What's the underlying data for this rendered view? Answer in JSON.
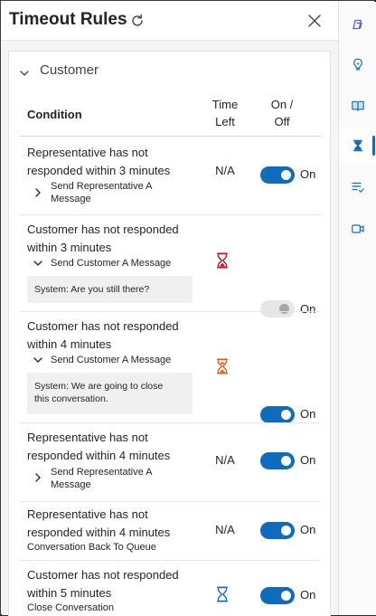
{
  "header": {
    "title": "Timeout Rules"
  },
  "section": {
    "title": "Customer"
  },
  "columns": {
    "condition": "Condition",
    "time_left_1": "Time",
    "time_left_2": "Left",
    "on_off_1": "On /",
    "on_off_2": "Off"
  },
  "rules": [
    {
      "condition_1": "Representative has not",
      "condition_2": "responded within 3 minutes",
      "action_1": "Send Representative A",
      "action_2": "Message",
      "time_left": "N/A",
      "toggle_state": "on",
      "toggle_label": "On"
    },
    {
      "condition_1": "Customer has not responded",
      "condition_2": "within 3 minutes",
      "action": "Send Customer A Message",
      "message": "System: Are you still there?",
      "time_icon": "hourglass-red-icon",
      "toggle_state": "off",
      "toggle_label": "On"
    },
    {
      "condition_1": "Customer has not responded",
      "condition_2": "within 4 minutes",
      "action": "Send Customer A Message",
      "message_1": "System: We are going to close",
      "message_2": "this conversation.",
      "time_icon": "hourglass-orange-icon",
      "toggle_state": "on",
      "toggle_label": "On"
    },
    {
      "condition_1": "Representative has not",
      "condition_2": "responded within 4 minutes",
      "action_1": "Send Representative A",
      "action_2": "Message",
      "time_left": "N/A",
      "toggle_state": "on",
      "toggle_label": "On"
    },
    {
      "condition_1": "Representative has not",
      "condition_2": "responded within 4 minutes",
      "action": "Conversation Back To Queue",
      "time_left": "N/A",
      "toggle_state": "on",
      "toggle_label": "On"
    },
    {
      "condition_1": "Customer has not responded",
      "condition_2": "within 5 minutes",
      "action": "Close Conversation",
      "time_icon": "hourglass-blue-icon",
      "toggle_state": "on",
      "toggle_label": "On"
    }
  ],
  "colors": {
    "accent": "#0f6cbd",
    "hourglass_red": "#c50f1f",
    "hourglass_orange": "#d0601a",
    "hourglass_blue": "#0f6cbd"
  },
  "rail_icons": [
    "copilot-icon",
    "lightbulb-icon",
    "knowledge-book-icon",
    "hourglass-icon",
    "checklist-icon",
    "video-icon"
  ]
}
